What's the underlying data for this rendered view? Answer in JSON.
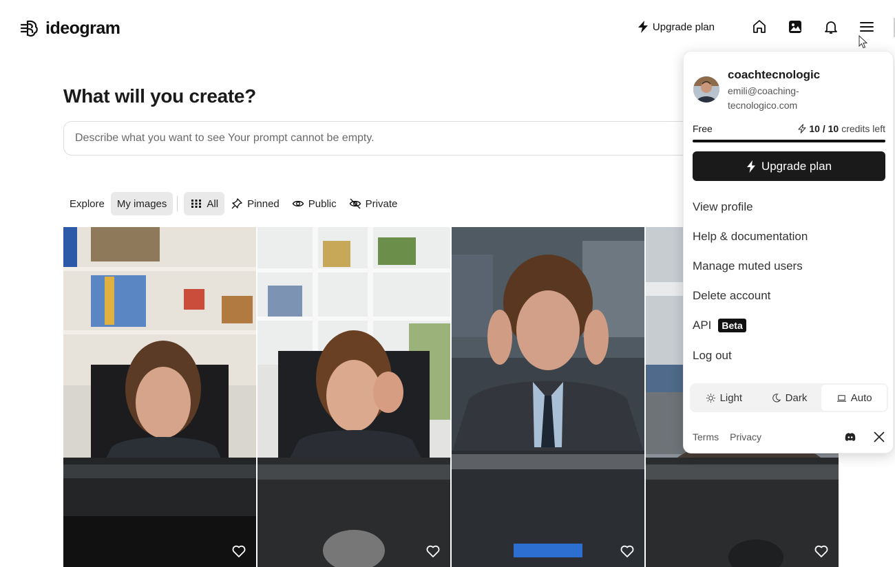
{
  "header": {
    "logo_text": "ideogram",
    "upgrade_label": "Upgrade plan",
    "icons": [
      "home-icon",
      "gallery-icon",
      "bell-icon",
      "menu-icon"
    ]
  },
  "main": {
    "title": "What will you create?",
    "prompt_placeholder": "Describe what you want to see Your prompt cannot be empty."
  },
  "filters": {
    "explore": "Explore",
    "my_images": "My images",
    "all": "All",
    "pinned": "Pinned",
    "public": "Public",
    "private": "Private",
    "active": [
      "My images",
      "All"
    ]
  },
  "gallery": {
    "items": [
      {
        "alt": "woman frowning at computer monitor in office",
        "icon": "heart-icon"
      },
      {
        "alt": "woman holding her forehead at monitor",
        "icon": "heart-icon"
      },
      {
        "alt": "woman pressing temples at monitor",
        "icon": "heart-icon"
      },
      {
        "alt": "woman at monitor in open office",
        "icon": "heart-icon"
      }
    ]
  },
  "account_menu": {
    "username": "coachtecnologic",
    "email": "emili@coaching-tecnologico.com",
    "plan": "Free",
    "credits_used": "10 / 10",
    "credits_suffix": "credits left",
    "credits_fraction": 1.0,
    "upgrade_label": "Upgrade plan",
    "items": {
      "view_profile": "View profile",
      "help": "Help & documentation",
      "muted": "Manage muted users",
      "delete": "Delete account",
      "api": "API",
      "api_badge": "Beta",
      "logout": "Log out"
    },
    "theme": {
      "light": "Light",
      "dark": "Dark",
      "auto": "Auto",
      "selected": "Auto"
    },
    "footer": {
      "terms": "Terms",
      "privacy": "Privacy",
      "icons": [
        "discord-icon",
        "x-icon"
      ]
    }
  },
  "colors": {
    "accent_dark": "#1a1a1a",
    "border": "#dcdcdc",
    "chip_active": "#e9e9e9"
  }
}
